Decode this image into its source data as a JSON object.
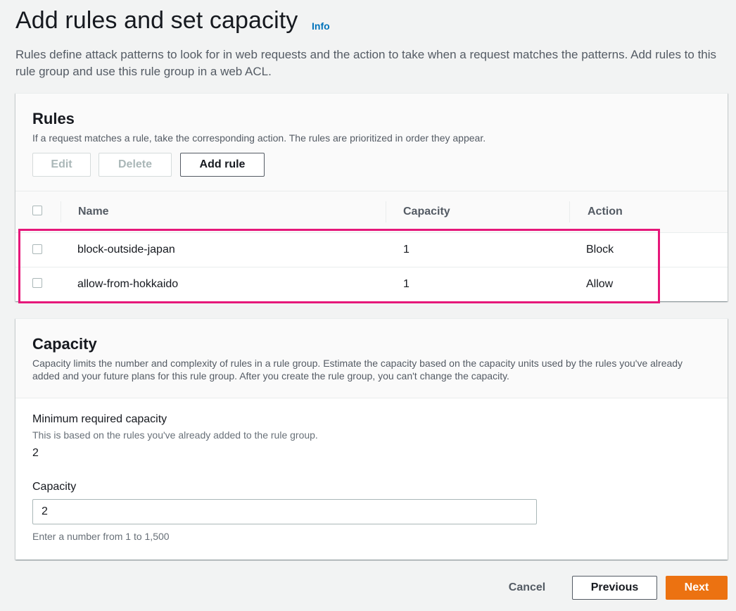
{
  "header": {
    "title": "Add rules and set capacity",
    "info_label": "Info",
    "description": "Rules define attack patterns to look for in web requests and the action to take when a request matches the patterns. Add rules to this rule group and use this rule group in a web ACL."
  },
  "rules_panel": {
    "title": "Rules",
    "description": "If a request matches a rule, take the corresponding action. The rules are prioritized in order they appear.",
    "buttons": {
      "edit": "Edit",
      "delete": "Delete",
      "add_rule": "Add rule"
    },
    "columns": [
      "Name",
      "Capacity",
      "Action"
    ],
    "rows": [
      {
        "name": "block-outside-japan",
        "capacity": "1",
        "action": "Block"
      },
      {
        "name": "allow-from-hokkaido",
        "capacity": "1",
        "action": "Allow"
      }
    ]
  },
  "capacity_panel": {
    "title": "Capacity",
    "description": "Capacity limits the number and complexity of rules in a rule group. Estimate the capacity based on the capacity units used by the rules you've already added and your future plans for this rule group. After you create the rule group, you can't change the capacity.",
    "min_label": "Minimum required capacity",
    "min_hint": "This is based on the rules you've already added to the rule group.",
    "min_value": "2",
    "capacity_label": "Capacity",
    "capacity_value": "2",
    "capacity_hint": "Enter a number from 1 to 1,500"
  },
  "footer": {
    "cancel": "Cancel",
    "previous": "Previous",
    "next": "Next"
  },
  "colors": {
    "primary": "#ec7211",
    "link": "#0073bb",
    "highlight": "#e6177a"
  }
}
